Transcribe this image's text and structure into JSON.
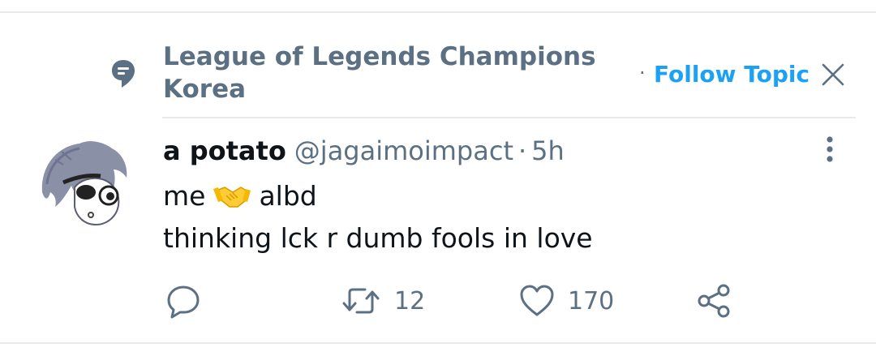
{
  "topic": {
    "name": "League of Legends Champions Korea",
    "separator": "·",
    "follow_label": "Follow Topic"
  },
  "tweet": {
    "display_name": "a potato",
    "handle": "@jagaimoimpact",
    "separator": "·",
    "time": "5h",
    "text_before_emoji": "me",
    "emoji": "handshake",
    "text_after_emoji": "albd",
    "line2": "thinking lck r dumb fools in love"
  },
  "actions": {
    "reply_count": "",
    "retweet_count": "12",
    "like_count": "170"
  },
  "colors": {
    "secondary_text": "#5b7083",
    "accent": "#1da1f2",
    "divider": "#e6eaed"
  },
  "icons": [
    "topic-icon",
    "close-icon",
    "more-icon",
    "reply-icon",
    "retweet-icon",
    "like-icon",
    "share-icon"
  ]
}
